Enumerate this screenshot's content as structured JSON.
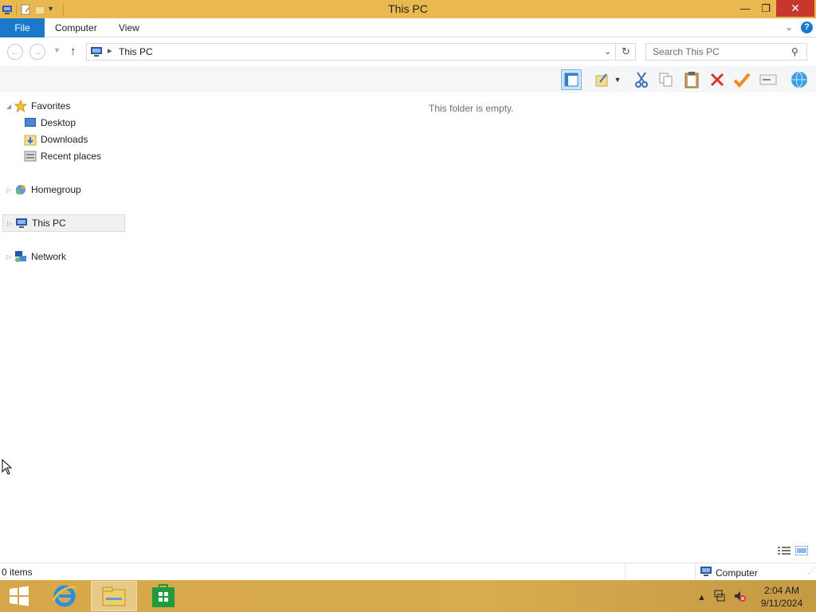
{
  "window": {
    "title": "This PC",
    "controls": {
      "minimize": "—",
      "maximize": "❐",
      "close": "✕"
    }
  },
  "ribbon": {
    "file_tab": "File",
    "tabs": [
      "Computer",
      "View"
    ]
  },
  "address": {
    "path": "This PC",
    "search_placeholder": "Search This PC"
  },
  "navigation": {
    "favorites": {
      "label": "Favorites",
      "items": [
        "Desktop",
        "Downloads",
        "Recent places"
      ]
    },
    "homegroup": "Homegroup",
    "this_pc": "This PC",
    "network": "Network"
  },
  "content": {
    "empty_message": "This folder is empty."
  },
  "status": {
    "item_count": "0 items",
    "location": "Computer"
  },
  "taskbar": {
    "time": "2:04 AM",
    "date": "9/11/2024"
  },
  "colors": {
    "titlebar": "#e9b950",
    "file_tab": "#1979ca",
    "close_button": "#c7372b",
    "taskbar": "#d6a74a"
  }
}
